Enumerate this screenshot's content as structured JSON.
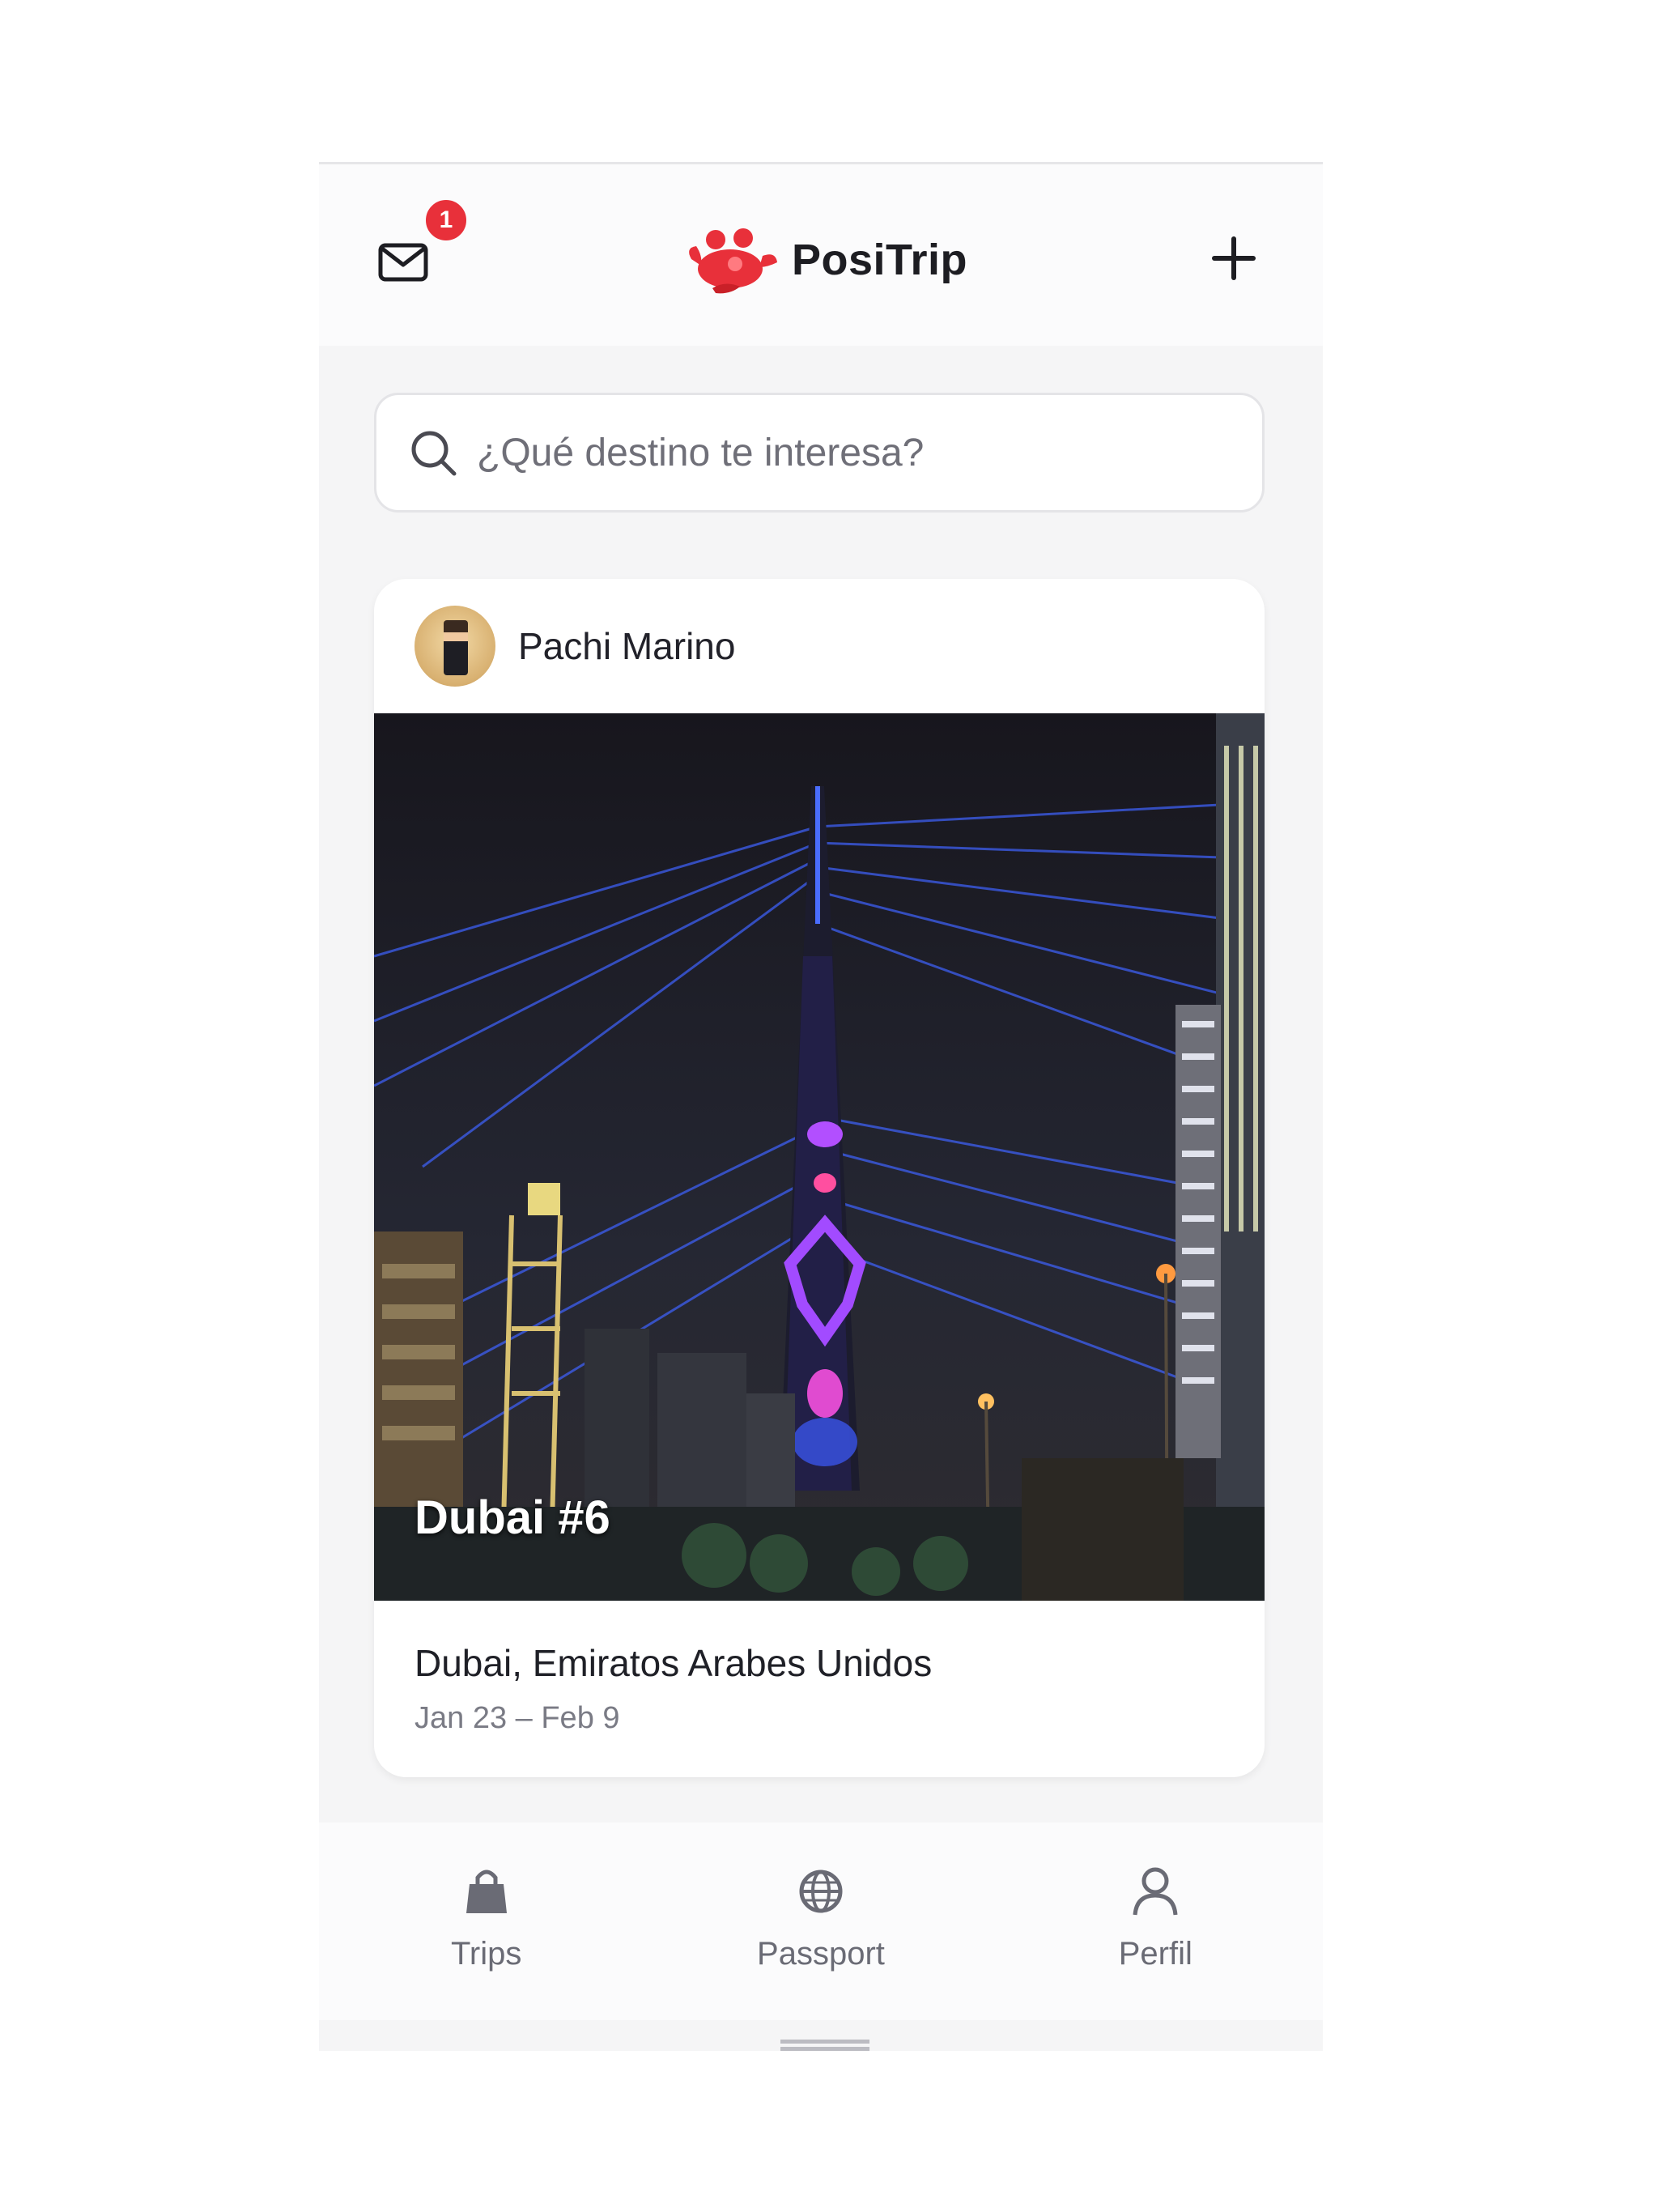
{
  "header": {
    "app_name": "PosiTrip",
    "notification_count": "1",
    "brand_color": "#e8303a"
  },
  "search": {
    "placeholder": "¿Qué destino te interesa?"
  },
  "post": {
    "author": "Pachi Marino",
    "trip_title": "Dubai #6",
    "location": "Dubai, Emiratos Arabes Unidos",
    "dates": "Jan 23 – Feb 9"
  },
  "nav": {
    "items": [
      {
        "label": "Trips",
        "icon": "shopping-bag-icon"
      },
      {
        "label": "Passport",
        "icon": "globe-icon"
      },
      {
        "label": "Perfil",
        "icon": "user-icon"
      }
    ]
  }
}
